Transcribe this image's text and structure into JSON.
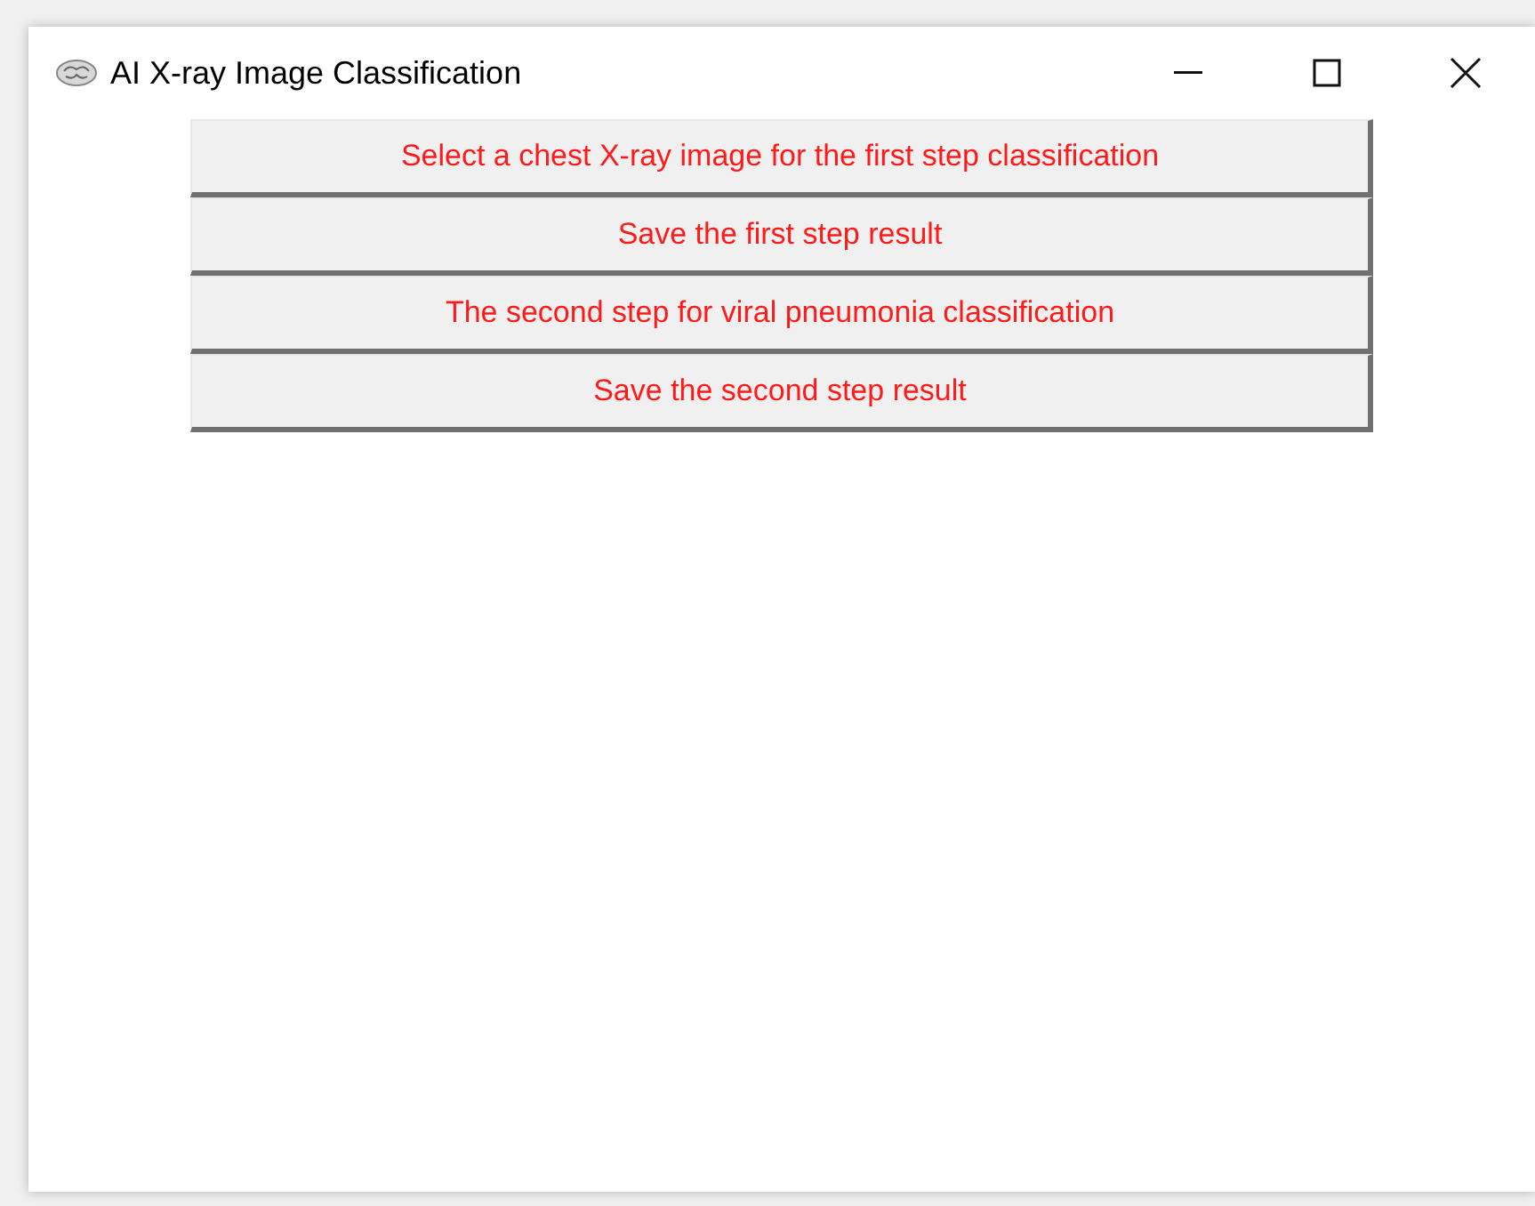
{
  "window": {
    "title": "AI X-ray Image Classification"
  },
  "buttons": [
    "Select a chest X-ray image for the first step classification",
    "Save the first step result",
    "The second step for viral pneumonia classification",
    "Save the second step result"
  ]
}
